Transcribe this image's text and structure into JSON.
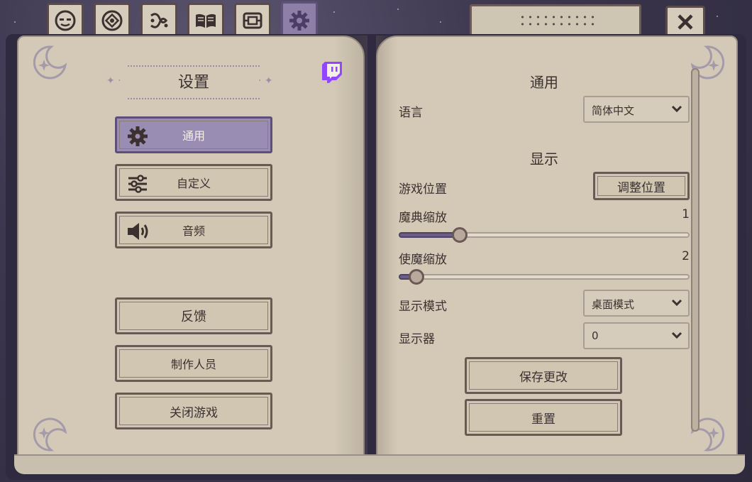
{
  "tabs": [
    {
      "icon": "mask-face-icon",
      "active": false
    },
    {
      "icon": "sigil-circle-icon",
      "active": false
    },
    {
      "icon": "knot-rune-icon",
      "active": false
    },
    {
      "icon": "open-book-icon",
      "active": false
    },
    {
      "icon": "scroll-map-icon",
      "active": false
    },
    {
      "icon": "gear-icon",
      "active": true
    }
  ],
  "close_icon": "close-icon",
  "left_page": {
    "title": "设置",
    "twitch_icon": "twitch-icon",
    "nav": [
      {
        "label": "通用",
        "icon": "gear-icon",
        "active": true
      },
      {
        "label": "自定义",
        "icon": "sliders-icon",
        "active": false
      },
      {
        "label": "音频",
        "icon": "speaker-icon",
        "active": false
      }
    ],
    "actions": [
      {
        "label": "反馈"
      },
      {
        "label": "制作人员"
      },
      {
        "label": "关闭游戏"
      }
    ]
  },
  "right_page": {
    "general": {
      "title": "通用",
      "language_label": "语言",
      "language_value": "简体中文"
    },
    "display": {
      "title": "显示",
      "game_position_label": "游戏位置",
      "adjust_position_button": "调整位置",
      "grimoire_scale_label": "魔典缩放",
      "grimoire_scale_value": "1",
      "grimoire_scale_fraction": 0.21,
      "familiar_scale_label": "使魔缩放",
      "familiar_scale_value": "2",
      "familiar_scale_fraction": 0.06,
      "display_mode_label": "显示模式",
      "display_mode_value": "桌面模式",
      "monitor_label": "显示器",
      "monitor_value": "0"
    },
    "save_button": "保存更改",
    "reset_button": "重置"
  },
  "colors": {
    "page": "#d3c9b6",
    "accent_purple": "#8e7fa7",
    "ink": "#3c3130",
    "twitch": "#9146ff"
  }
}
